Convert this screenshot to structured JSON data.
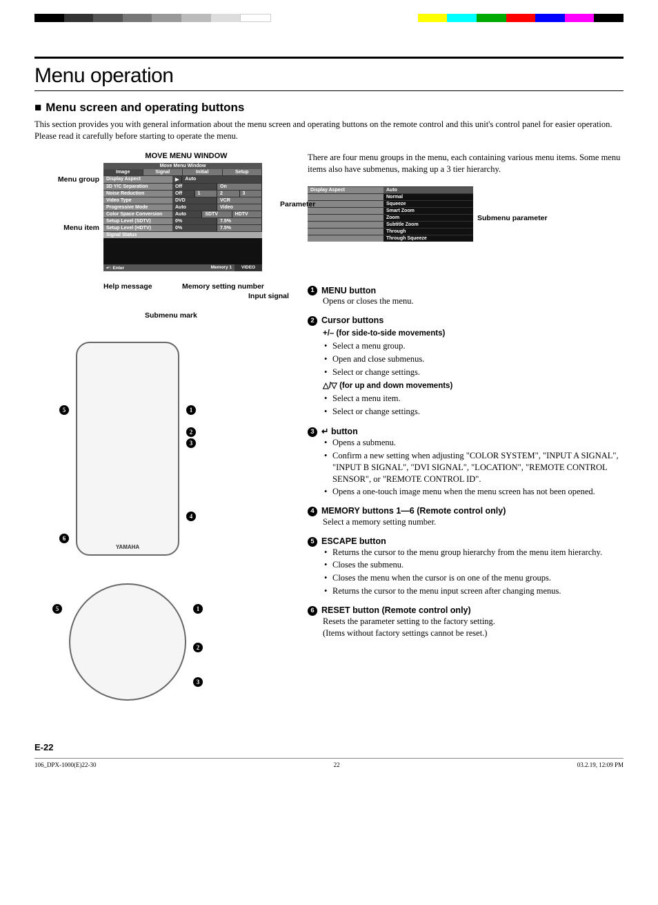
{
  "colorbar": [
    "#000",
    "#333",
    "#555",
    "#777",
    "#999",
    "#bbb",
    "#ddd",
    "#fff",
    "#fff",
    "#fff",
    "#fff",
    "#fff",
    "#fff",
    "#fff",
    "#ff0",
    "#0ff",
    "#0a0",
    "#f00",
    "#00f",
    "#f0f",
    "#000"
  ],
  "title": "Menu operation",
  "h2": "Menu screen and operating buttons",
  "intro": "This section provides you with general information about the menu screen and operating buttons on the remote control and this unit's control panel for easier operation. Please read it carefully before starting to operate the menu.",
  "moveLabel": "MOVE MENU WINDOW",
  "sideLabels": {
    "menuGroup": "Menu group",
    "menuItem": "Menu item",
    "helpMessage": "Help message",
    "submenuMark": "Submenu mark",
    "memorySetting": "Memory setting number",
    "inputSignal": "Input signal",
    "parameter": "Parameter",
    "submenuParameter": "Submenu parameter"
  },
  "menu": {
    "header": "Move Menu Window",
    "tabs": [
      "Image",
      "Signal",
      "Initial",
      "Setup"
    ],
    "rows": [
      {
        "label": "Display Aspect",
        "vals": [
          "Auto"
        ],
        "full": true,
        "mark": "▶"
      },
      {
        "label": "3D Y/C Separation",
        "vals": [
          "Off",
          "On"
        ]
      },
      {
        "label": "Noise Reduction",
        "vals": [
          "Off",
          "1",
          "2",
          "3"
        ]
      },
      {
        "label": "Video Type",
        "vals": [
          "DVD",
          "VCR"
        ]
      },
      {
        "label": "Progressive Mode",
        "vals": [
          "Auto",
          "Video"
        ]
      },
      {
        "label": "Color Space Conversion",
        "vals": [
          "Auto",
          "SDTV",
          "HDTV"
        ]
      },
      {
        "label": "Setup Level (SDTV)",
        "vals": [
          "0%",
          "7.5%"
        ]
      },
      {
        "label": "Setup Level (HDTV)",
        "vals": [
          "0%",
          "7.5%"
        ]
      },
      {
        "label": "Signal Status",
        "vals": [],
        "fullgrey": true
      }
    ],
    "footer": {
      "enter": "↵: Enter",
      "memory": "Memory 1",
      "signal": "VIDEO"
    }
  },
  "submenu": {
    "header": "Display Aspect",
    "items": [
      "Auto",
      "Normal",
      "Squeeze",
      "Smart Zoom",
      "Zoom",
      "Subtitle Zoom",
      "Through",
      "Through Squeeze"
    ]
  },
  "rightIntro": "There are four menu groups in the menu, each containing various menu items. Some menu items also have submenus, making up a 3 tier hierarchy.",
  "buttons": [
    {
      "num": "1",
      "title": "MENU button",
      "body": "Opens or closes the menu."
    },
    {
      "num": "2",
      "title": "Cursor buttons",
      "sections": [
        {
          "sub": "+/– (for side-to-side movements)",
          "items": [
            "Select a menu group.",
            "Open and close submenus.",
            "Select or change settings."
          ]
        },
        {
          "sub": "△/▽ (for up and down movements)",
          "items": [
            "Select a menu item.",
            "Select or change settings."
          ]
        }
      ]
    },
    {
      "num": "3",
      "title": "↵ button",
      "items": [
        "Opens a submenu.",
        "Confirm a new setting when adjusting \"COLOR SYSTEM\", \"INPUT A SIGNAL\", \"INPUT B SIGNAL\", \"DVI SIGNAL\", \"LOCATION\", \"REMOTE CONTROL SENSOR\", or \"REMOTE CONTROL ID\".",
        "Opens a one-touch image menu when the menu screen has not been opened."
      ]
    },
    {
      "num": "4",
      "title": "MEMORY buttons 1—6 (Remote control only)",
      "body": "Select a memory setting number."
    },
    {
      "num": "5",
      "title": "ESCAPE button",
      "items": [
        "Returns the cursor to the menu group hierarchy from the menu item hierarchy.",
        "Closes the submenu.",
        "Closes the menu when the cursor is on one of the menu groups.",
        "Returns the cursor to the menu input screen after changing menus."
      ]
    },
    {
      "num": "6",
      "title": "RESET button (Remote control only)",
      "body": "Resets the parameter setting to the factory setting.\n(Items without factory settings cannot be reset.)"
    }
  ],
  "pageNumber": "E-22",
  "footer": {
    "file": "106_DPX-1000(E)22-30",
    "page": "22",
    "date": "03.2.19, 12:09 PM"
  }
}
